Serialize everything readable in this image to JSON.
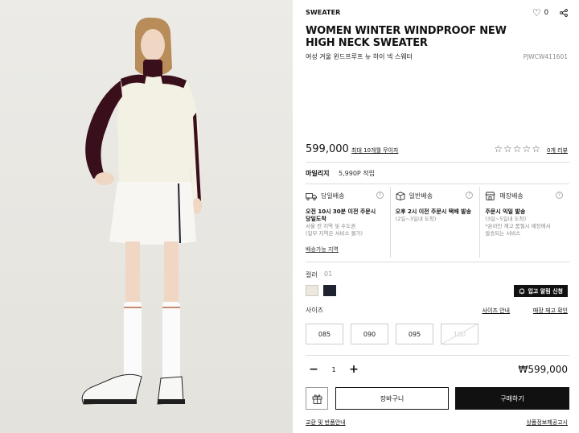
{
  "product": {
    "category": "SWEATER",
    "wish_count": "0",
    "title": "WOMEN WINTER WINDPROOF NEW HIGH NECK SWEATER",
    "subtitle": "여성 겨울 윈드프루프 뉴 하이 넥 스웨터",
    "code": "PJWCW411601",
    "image_alt": "Model wearing ivory high neck sweater with burgundy sleeves and white skirt"
  },
  "pricing": {
    "price": "599,000",
    "installment": "최대 10개월 무이자",
    "rating_stars": "☆☆☆☆☆",
    "review_count": "0개 리뷰",
    "total_price": "₩599,000"
  },
  "mileage": {
    "label": "마일리지",
    "value": "5,990P 적립"
  },
  "delivery": {
    "options": [
      {
        "icon": "truck-icon",
        "title": "당일배송",
        "bold": [
          "오전 10시 30분 이전 주문시",
          "당일도착"
        ],
        "sub": [
          "서울 전 지역 및 수도권",
          "(일부 지역은 서비스 불가)"
        ]
      },
      {
        "icon": "box-icon",
        "title": "일반배송",
        "bold": [
          "오후 2시 이전 주문시 택배 발송"
        ],
        "sub": [
          "(2일~3일내 도착)"
        ]
      },
      {
        "icon": "store-icon",
        "title": "매장배송",
        "bold": [
          "주문시 익일 발송"
        ],
        "sub": [
          "(3일~5일내 도착)",
          "*온라인 재고 품절시 매장에서",
          "발송되는 서비스"
        ]
      }
    ],
    "region_link": "배송가능 지역"
  },
  "color": {
    "label": "컬러",
    "selected_code": "01",
    "swatches": [
      "#ece8df",
      "#1f2330"
    ],
    "restock_label": "입고 알림 신청"
  },
  "size": {
    "label": "사이즈",
    "guide_link": "사이즈 안내",
    "stock_link": "매장 재고 확인",
    "options": [
      {
        "label": "085",
        "available": true
      },
      {
        "label": "090",
        "available": true
      },
      {
        "label": "095",
        "available": true
      },
      {
        "label": "100",
        "available": false
      }
    ]
  },
  "quantity": {
    "minus": "−",
    "value": "1",
    "plus": "+"
  },
  "actions": {
    "cart": "장바구니",
    "buy": "구매하기",
    "exchange_link": "교환 및 반품안내",
    "notice_link": "상품정보제공고시"
  }
}
